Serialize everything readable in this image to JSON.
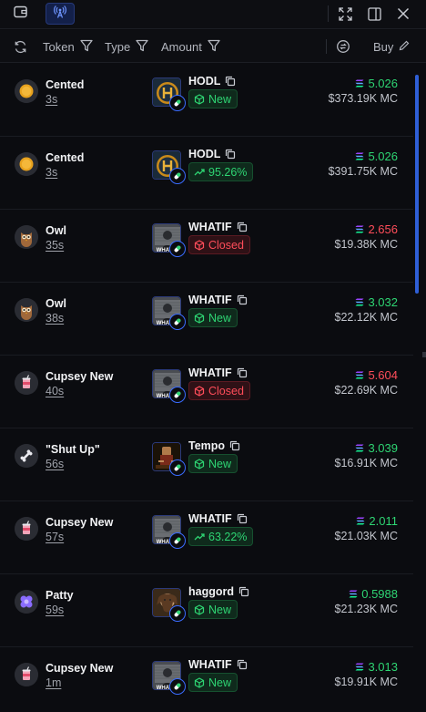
{
  "toolbar": {
    "wallet_icon": "wallet-icon",
    "signal_icon": "broadcast-icon",
    "expand_icon": "expand-icon",
    "panel_icon": "sidebar-panel-icon",
    "close_icon": "close-icon"
  },
  "filters": {
    "token_label": "Token",
    "type_label": "Type",
    "amount_label": "Amount",
    "buy_label": "Buy"
  },
  "colors": {
    "accent": "#2f5fd6",
    "green": "#2ed573",
    "red": "#ff4d5a"
  },
  "rows": [
    {
      "name": "Cented",
      "age": "3s",
      "avatar": "coin-avatar",
      "ticker": "HODL",
      "thumb": "hodl",
      "badge": "New",
      "badge_type": "new",
      "badge_color": "green",
      "amount": "5.026",
      "amount_color": "green",
      "mc": "$373.19K MC"
    },
    {
      "name": "Cented",
      "age": "3s",
      "avatar": "coin-avatar",
      "ticker": "HODL",
      "thumb": "hodl",
      "badge": "95.26%",
      "badge_type": "trend",
      "badge_color": "green",
      "amount": "5.026",
      "amount_color": "green",
      "mc": "$391.75K MC"
    },
    {
      "name": "Owl",
      "age": "35s",
      "avatar": "owl-avatar",
      "ticker": "WHATIF",
      "thumb": "whatif",
      "badge": "Closed",
      "badge_type": "closed",
      "badge_color": "red",
      "amount": "2.656",
      "amount_color": "red",
      "mc": "$19.38K MC"
    },
    {
      "name": "Owl",
      "age": "38s",
      "avatar": "owl-avatar",
      "ticker": "WHATIF",
      "thumb": "whatif",
      "badge": "New",
      "badge_type": "new",
      "badge_color": "green",
      "amount": "3.032",
      "amount_color": "green",
      "mc": "$22.12K MC"
    },
    {
      "name": "Cupsey New",
      "age": "40s",
      "avatar": "cup-avatar",
      "ticker": "WHATIF",
      "thumb": "whatif",
      "badge": "Closed",
      "badge_type": "closed",
      "badge_color": "red",
      "amount": "5.604",
      "amount_color": "red",
      "mc": "$22.69K MC"
    },
    {
      "name": "\"Shut Up\"",
      "age": "56s",
      "avatar": "bone-avatar",
      "ticker": "Tempo",
      "thumb": "tempo",
      "badge": "New",
      "badge_type": "new",
      "badge_color": "green",
      "amount": "3.039",
      "amount_color": "green",
      "mc": "$16.91K MC"
    },
    {
      "name": "Cupsey New",
      "age": "57s",
      "avatar": "cup-avatar",
      "ticker": "WHATIF",
      "thumb": "whatif",
      "badge": "63.22%",
      "badge_type": "trend",
      "badge_color": "green",
      "amount": "2.011",
      "amount_color": "green",
      "mc": "$21.03K MC"
    },
    {
      "name": "Patty",
      "age": "59s",
      "avatar": "flower-avatar",
      "ticker": "haggord",
      "thumb": "haggord",
      "badge": "New",
      "badge_type": "new",
      "badge_color": "green",
      "amount": "0.5988",
      "amount_color": "green",
      "mc": "$21.23K MC"
    },
    {
      "name": "Cupsey New",
      "age": "1m",
      "avatar": "cup-avatar",
      "ticker": "WHATIF",
      "thumb": "whatif",
      "badge": "New",
      "badge_type": "new",
      "badge_color": "green",
      "amount": "3.013",
      "amount_color": "green",
      "mc": "$19.91K MC"
    }
  ]
}
